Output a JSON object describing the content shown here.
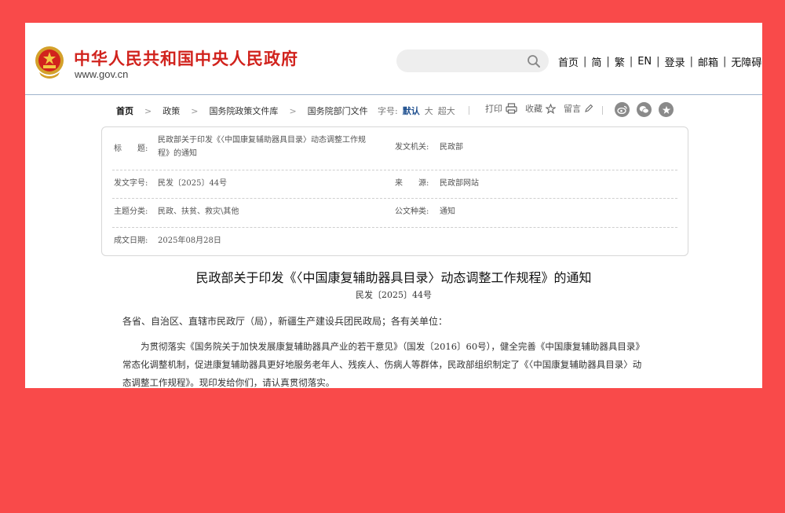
{
  "header": {
    "site_title": "中华人民共和国中央人民政府",
    "site_url": "www.gov.cn",
    "search_placeholder": "",
    "nav": [
      "首页",
      "简",
      "繁",
      "EN",
      "登录",
      "邮箱",
      "无障碍"
    ]
  },
  "breadcrumb": [
    "首页",
    "政策",
    "国务院政策文件库",
    "国务院部门文件"
  ],
  "font_size": {
    "label": "字号:",
    "options": [
      "默认",
      "大",
      "超大"
    ],
    "active": "默认"
  },
  "tools": {
    "print": "打印",
    "favorite": "收藏",
    "comment": "留言"
  },
  "share_icons": [
    "weibo-icon",
    "wechat-icon",
    "favorite-star-icon"
  ],
  "meta": {
    "title_label": "标　　题:",
    "title_value_line1": "民政部关于印发《〈中国康复辅助器具目录〉动态调整工作规",
    "title_value_line2": "程》的通知",
    "issuer_label": "发文机关:",
    "issuer_value": "民政部",
    "doc_no_label": "发文字号:",
    "doc_no_value": "民发〔2025〕44号",
    "source_label": "来　　源:",
    "source_value": "民政部网站",
    "topic_label": "主题分类:",
    "topic_value": "民政、扶贫、救灾\\其他",
    "doc_type_label": "公文种类:",
    "doc_type_value": "通知",
    "date_label": "成文日期:",
    "date_value": "2025年08月28日"
  },
  "article": {
    "title": "民政部关于印发《〈中国康复辅助器具目录〉动态调整工作规程》的通知",
    "doc_number": "民发〔2025〕44号",
    "salutation": "各省、自治区、直辖市民政厅（局），新疆生产建设兵团民政局；各有关单位：",
    "para_line1": "为贯彻落实《国务院关于加快发展康复辅助器具产业的若干意见》（国发〔2016〕60号），健全完善《中国康复辅助器具目录》",
    "para_line2": "常态化调整机制，促进康复辅助器具更好地服务老年人、残疾人、伤病人等群体，民政部组织制定了《〈中国康复辅助器具目录〉动",
    "para_line3": "态调整工作规程》。现印发给你们，请认真贯彻落实。"
  },
  "colors": {
    "brand_red": "#d1231d",
    "background": "#f94a4a",
    "active_blue": "#1e4f8f"
  }
}
